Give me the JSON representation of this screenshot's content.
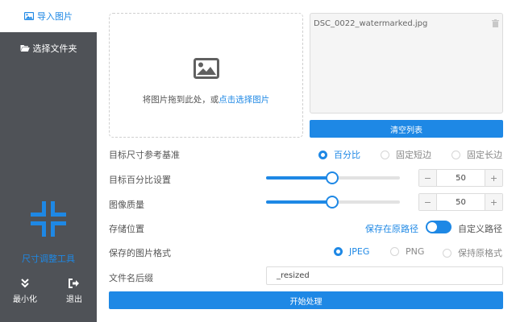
{
  "sidebar": {
    "nav_import": "导入图片",
    "nav_folder": "选择文件夹",
    "tool_name": "尺寸调整工具",
    "minimize_label": "最小化",
    "exit_label": "退出"
  },
  "dropzone": {
    "text_prefix": "将图片拖到此处，或",
    "text_link": "点击选择图片"
  },
  "filelist": {
    "items": [
      "DSC_0022_watermarked.jpg"
    ],
    "clear_label": "清空列表"
  },
  "form": {
    "ref_label": "目标尺寸参考基准",
    "ref_options": [
      "百分比",
      "固定短边",
      "固定长边"
    ],
    "ref_selected": "百分比",
    "percent_label": "目标百分比设置",
    "percent_value": "50",
    "quality_label": "图像质量",
    "quality_value": "50",
    "storage_label": "存储位置",
    "storage_on_label": "保存在原路径",
    "storage_off_label": "自定义路径",
    "storage_original_path": true,
    "format_label": "保存的图片格式",
    "format_options": [
      "JPEG",
      "PNG",
      "保持原格式"
    ],
    "format_selected": "JPEG",
    "suffix_label": "文件名后缀",
    "suffix_value": "_resized",
    "start_label": "开始处理"
  },
  "colors": {
    "accent": "#1e88e5",
    "sidebar_bg": "#4f5257"
  },
  "icons": {
    "import": "image-icon",
    "folder": "folder-open-icon",
    "logo": "compress-arrows-icon",
    "minimize": "double-chevron-down-icon",
    "exit": "sign-out-icon",
    "trash": "trash-icon"
  }
}
